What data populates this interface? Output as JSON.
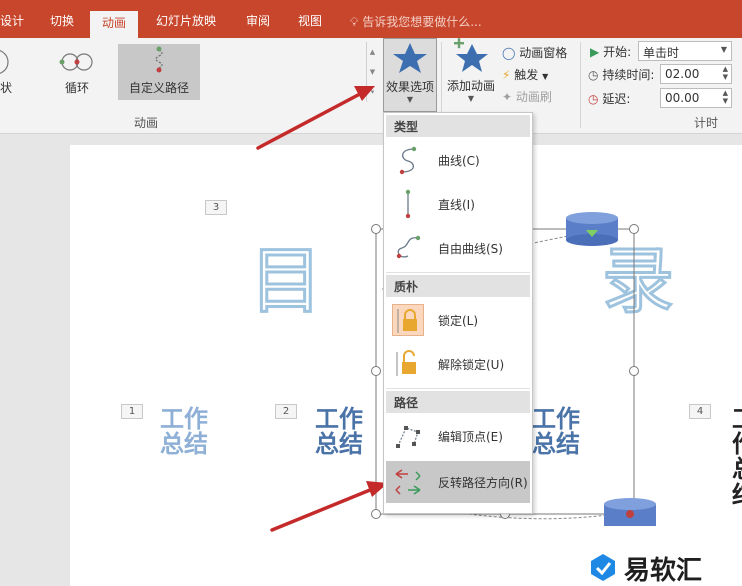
{
  "tabs": [
    {
      "label": "设计"
    },
    {
      "label": "切换"
    },
    {
      "label": "动画"
    },
    {
      "label": "幻灯片放映"
    },
    {
      "label": "审阅"
    },
    {
      "label": "视图"
    }
  ],
  "tell_me": "告诉我您想要做什么...",
  "ribbon": {
    "animations": [
      {
        "label": "状"
      },
      {
        "label": "循环"
      },
      {
        "label": "自定义路径"
      }
    ],
    "animation_group_label": "动画",
    "effect_options_label": "效果选项",
    "add_animation_label": "添加动画",
    "animation_pane_label": "动画窗格",
    "trigger_label": "触发",
    "animation_painter_label": "动画刷",
    "start_label": "开始:",
    "start_value": "单击时",
    "duration_label": "持续时间:",
    "duration_value": "02.00",
    "delay_label": "延迟:",
    "delay_value": "00.00",
    "timing_group_label": "计时"
  },
  "slide": {
    "num_3": "3",
    "num_1": "1",
    "num_2": "2",
    "num_4": "4",
    "char_mu": "目",
    "char_lu": "录",
    "work_lines": [
      "工作",
      "总结"
    ]
  },
  "dropdown": {
    "section_type": "类型",
    "curve": "曲线(C)",
    "line": "直线(I)",
    "freeform": "自由曲线(S)",
    "section_lock": "质朴",
    "locked": "锁定(L)",
    "unlocked": "解除锁定(U)",
    "section_path": "路径",
    "edit_points": "编辑顶点(E)",
    "reverse_path": "反转路径方向(R)"
  },
  "watermark": "易软汇",
  "colors": {
    "ribbon_red": "#c8462c",
    "arrow_red": "#c42a2a",
    "work_blue": "#4a73a8"
  }
}
